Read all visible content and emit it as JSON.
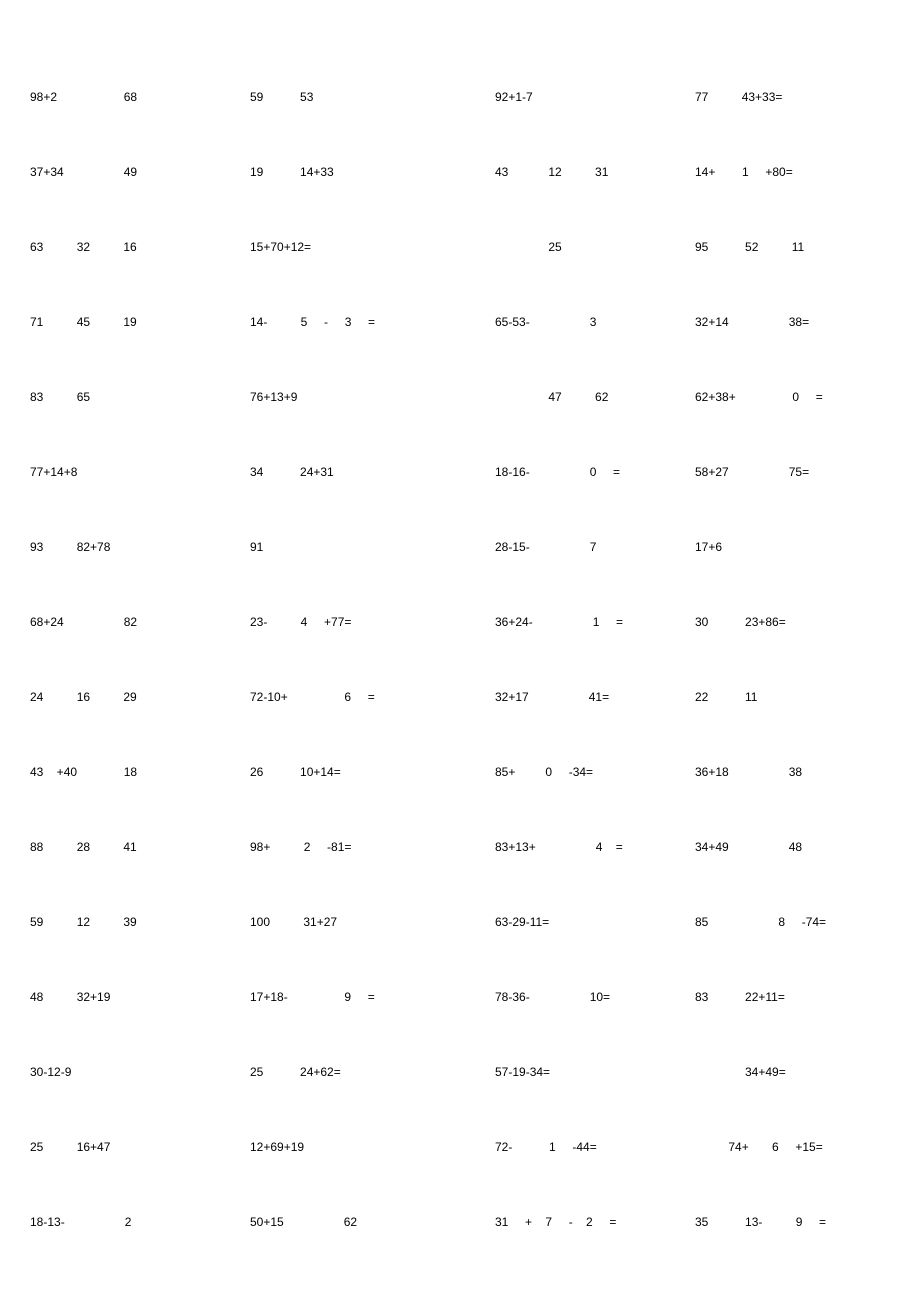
{
  "rows": [
    {
      "c1": "98+2                    68",
      "c2": "59           53",
      "c3": "92+1-7",
      "c4": "77          43+33="
    },
    {
      "c1": "37+34                  49",
      "c2": "19           14+33",
      "c3": "43            12          31",
      "c4": "14+        1     +80="
    },
    {
      "c1": "63          32          16",
      "c2": "15+70+12=",
      "c3": "                25",
      "c4": "95           52          11"
    },
    {
      "c1": "71          45          19",
      "c2": "14-          5     -     3     =",
      "c3": "65-53-                  3",
      "c4": "32+14                  38="
    },
    {
      "c1": "83          65",
      "c2": "76+13+9",
      "c3": "                47          62",
      "c4": "62+38+                 0     ="
    },
    {
      "c1": "77+14+8",
      "c2": "34           24+31",
      "c3": "18-16-                  0     =",
      "c4": "58+27                  75="
    },
    {
      "c1": "93          82+78",
      "c2": "91",
      "c3": "28-15-                  7",
      "c4": "17+6"
    },
    {
      "c1": "68+24                  82",
      "c2": "23-          4     +77=",
      "c3": "36+24-                  1     =",
      "c4": "30           23+86="
    },
    {
      "c1": "24          16          29",
      "c2": "72-10+                 6     =",
      "c3": "32+17                  41=",
      "c4": "22           11"
    },
    {
      "c1": "43    +40              18",
      "c2": "26           10+14=",
      "c3": "85+         0     -34=",
      "c4": "36+18                  38"
    },
    {
      "c1": "88          28          41",
      "c2": "98+          2     -81=",
      "c3": "83+13+                  4    =",
      "c4": "34+49                  48"
    },
    {
      "c1": "59          12          39",
      "c2": "100          31+27",
      "c3": "63-29-11=",
      "c4": "85                     8     -74="
    },
    {
      "c1": "48          32+19",
      "c2": "17+18-                 9     =",
      "c3": "78-36-                  10=",
      "c4": "83           22+11="
    },
    {
      "c1": "30-12-9",
      "c2": "25           24+62=",
      "c3": "57-19-34=",
      "c4": "               34+49="
    },
    {
      "c1": "25          16+47",
      "c2": "12+69+19",
      "c3": "72-           1     -44=",
      "c4": "          74+       6     +15="
    },
    {
      "c1": "18-13-                  2",
      "c2": "50+15                  62",
      "c3": "31     +    7     -    2     =",
      "c4": "35           13-          9     ="
    }
  ]
}
